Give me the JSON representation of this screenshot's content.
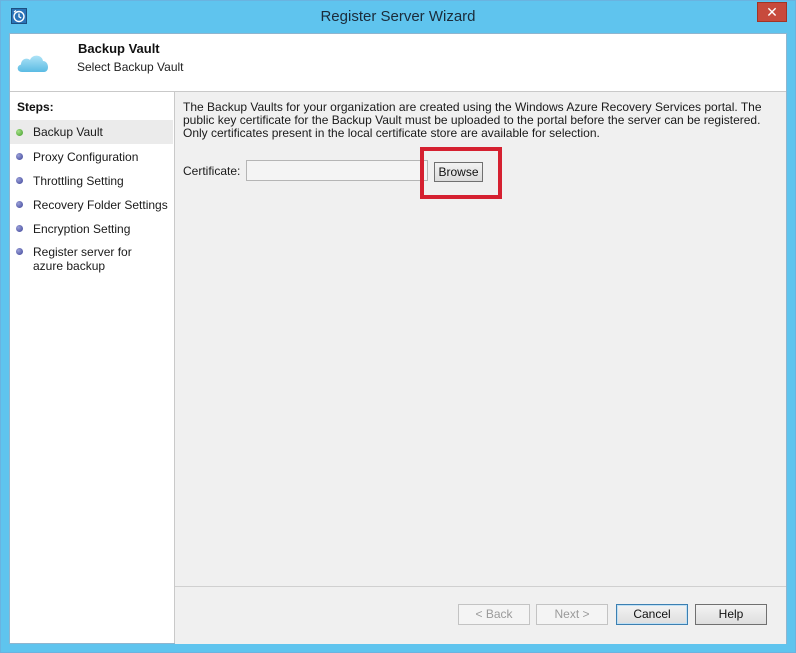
{
  "window": {
    "title": "Register Server Wizard",
    "close_glyph": "✕",
    "app_icon": "clock-backup-icon",
    "accent_color": "#5fc4ee"
  },
  "header": {
    "title": "Backup Vault",
    "subtitle": "Select Backup Vault",
    "icon": "cloud-icon"
  },
  "steps": {
    "label": "Steps:",
    "items": [
      {
        "label": "Backup Vault",
        "state": "current"
      },
      {
        "label": "Proxy Configuration",
        "state": "pending"
      },
      {
        "label": "Throttling Setting",
        "state": "pending"
      },
      {
        "label": "Recovery Folder Settings",
        "state": "pending"
      },
      {
        "label": "Encryption Setting",
        "state": "pending"
      },
      {
        "label": "Register server for azure backup",
        "state": "pending"
      }
    ]
  },
  "content": {
    "description": "The Backup Vaults for your organization are created using the Windows Azure Recovery Services portal. The public key certificate for the Backup Vault must be uploaded to the portal before the server can be registered. Only certificates present in the local certificate store are available for selection.",
    "certificate_label": "Certificate:",
    "certificate_value": "",
    "browse_label": "Browse",
    "highlight_color": "#d52030"
  },
  "footer": {
    "back_label": "< Back",
    "next_label": "Next >",
    "cancel_label": "Cancel",
    "help_label": "Help"
  }
}
